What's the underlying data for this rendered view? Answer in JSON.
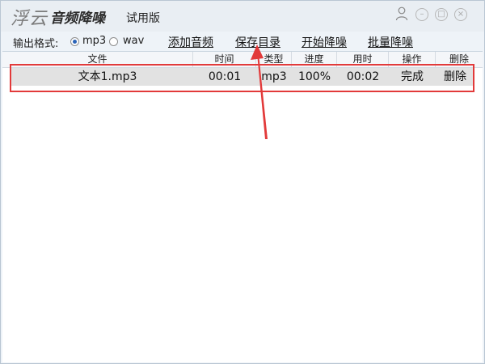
{
  "titlebar": {
    "logo_mark": "浮云",
    "app_name": "音频降噪",
    "edition": "试用版",
    "icons": [
      "user-icon",
      "minimize-icon",
      "restore-icon",
      "close-icon"
    ]
  },
  "toolbar": {
    "format_label": "输出格式:",
    "formats": [
      {
        "label": "mp3",
        "selected": true
      },
      {
        "label": "wav",
        "selected": false
      }
    ],
    "actions": [
      "添加音频",
      "保存目录",
      "开始降噪",
      "批量降噪"
    ]
  },
  "table": {
    "columns": [
      "文件",
      "时间",
      "类型",
      "进度",
      "用时",
      "操作",
      "删除"
    ],
    "rows": [
      {
        "file": "文本1.mp3",
        "time": "00:01",
        "type": "mp3",
        "progress": "100%",
        "elapsed": "00:02",
        "status": "完成",
        "delete": "删除"
      }
    ]
  },
  "annotation": {
    "color": "#e23a3a"
  }
}
